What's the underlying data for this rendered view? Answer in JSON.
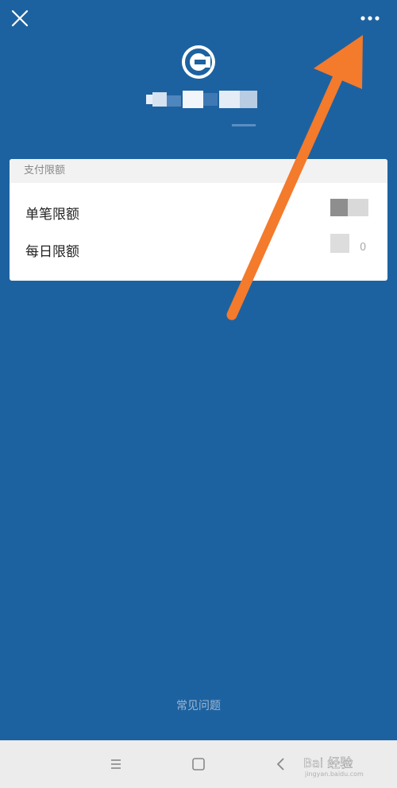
{
  "header": {
    "close_icon": "close-icon",
    "more_icon": "more-icon"
  },
  "bank": {
    "logo_icon": "bank-logo-icon"
  },
  "limits_card": {
    "title": "支付限额",
    "rows": [
      {
        "label": "单笔限额"
      },
      {
        "label": "每日限额",
        "value_tail": "0"
      }
    ]
  },
  "footer": {
    "faq_label": "常见问题"
  },
  "system_nav": {
    "menu_icon": "menu-icon",
    "home_icon": "home-icon",
    "back_icon": "back-icon"
  },
  "watermark": {
    "text": "Bai 经验",
    "sub": "jingyan.baidu.com"
  },
  "colors": {
    "background": "#1d62a0",
    "arrow": "#f47a2c",
    "card": "#ffffff",
    "navbar": "#ececec"
  }
}
